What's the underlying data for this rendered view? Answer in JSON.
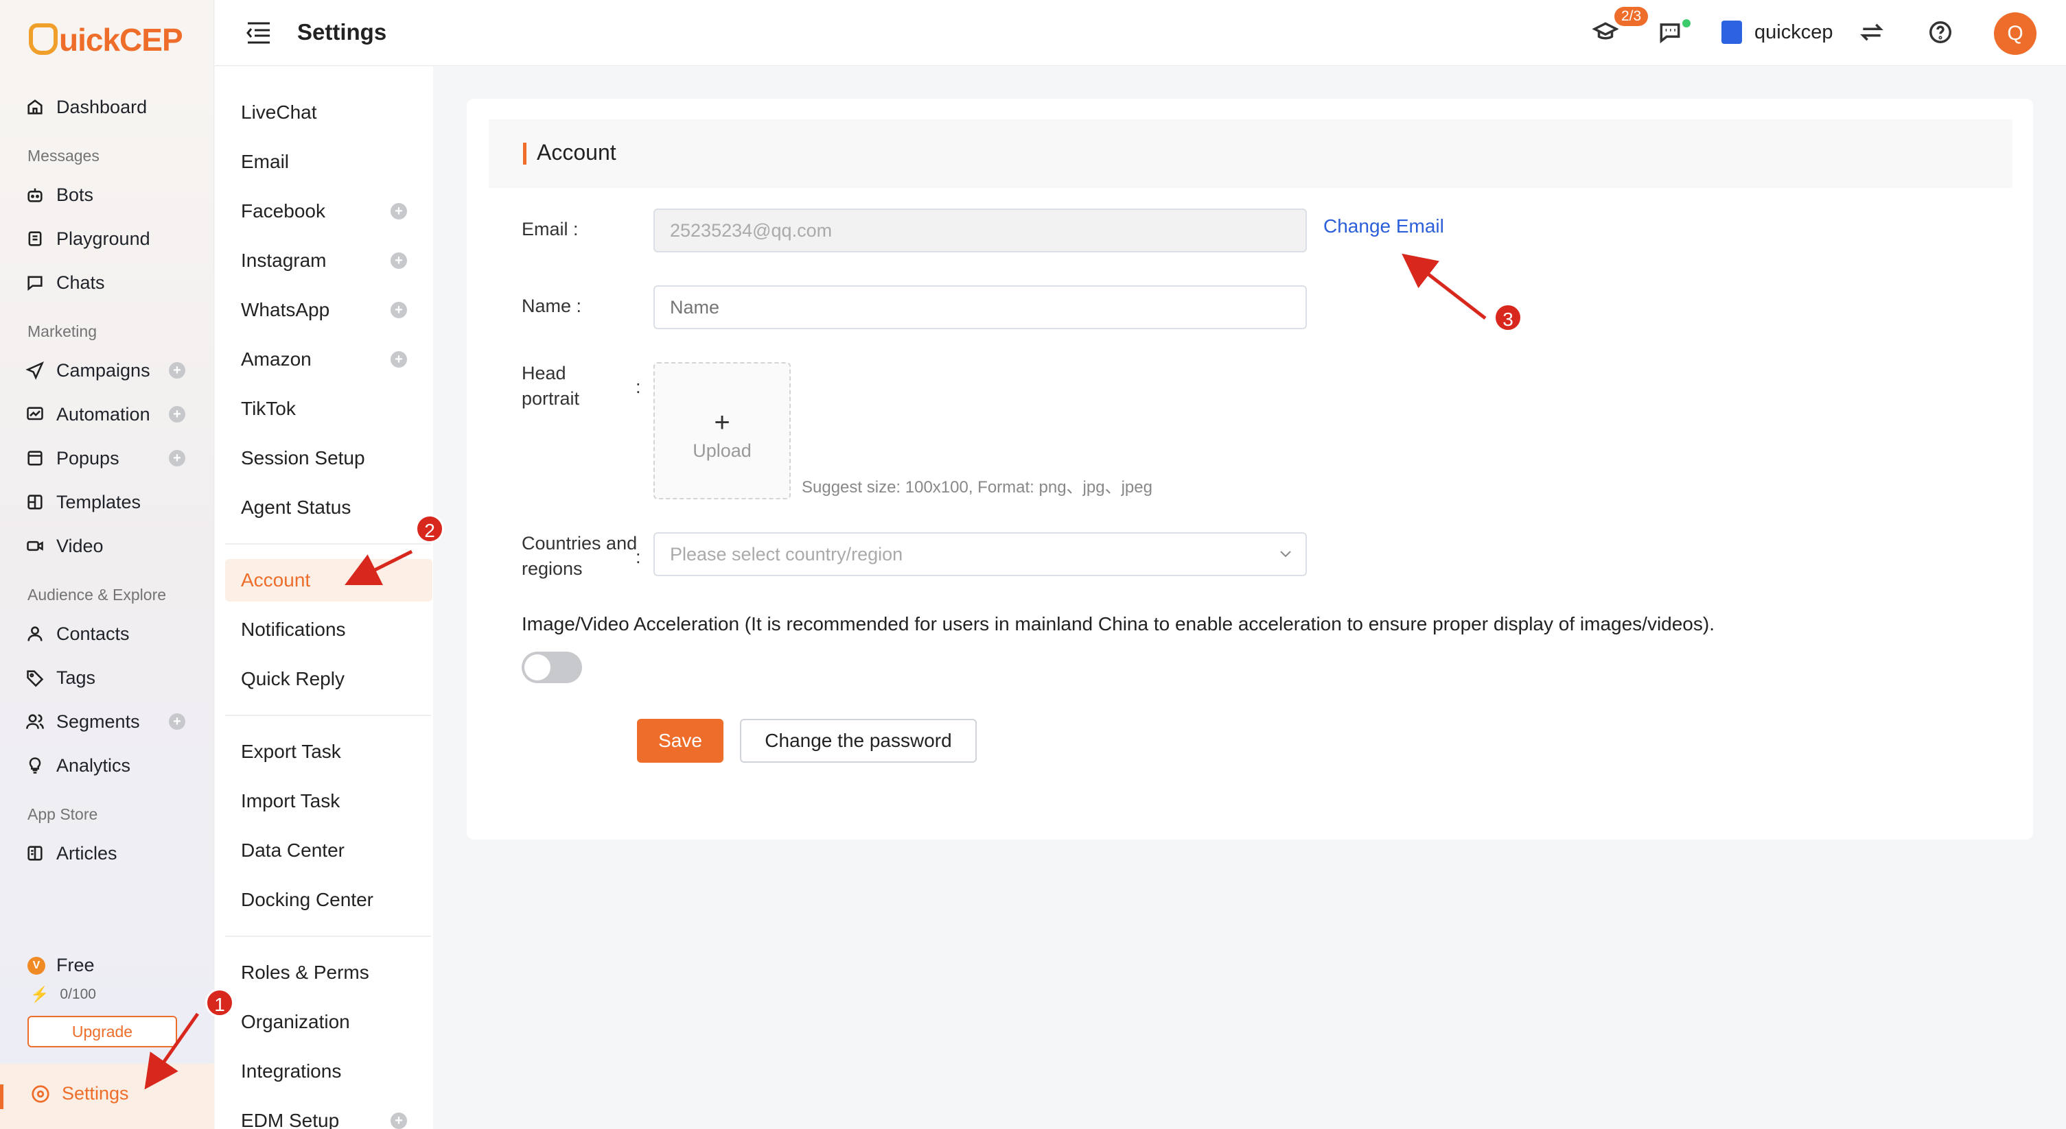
{
  "brand": {
    "logo_text": "uickCEP"
  },
  "sidebar": {
    "items": [
      {
        "label": "Dashboard",
        "icon": "home-icon"
      },
      {
        "group": "Messages"
      },
      {
        "label": "Bots",
        "icon": "bot-icon"
      },
      {
        "label": "Playground",
        "icon": "playground-icon"
      },
      {
        "label": "Chats",
        "icon": "chat-icon"
      },
      {
        "group": "Marketing"
      },
      {
        "label": "Campaigns",
        "icon": "send-icon"
      },
      {
        "label": "Automation",
        "icon": "automation-icon"
      },
      {
        "label": "Popups",
        "icon": "popup-icon"
      },
      {
        "label": "Templates",
        "icon": "template-icon"
      },
      {
        "label": "Video",
        "icon": "video-icon"
      },
      {
        "group": "Audience & Explore"
      },
      {
        "label": "Contacts",
        "icon": "user-icon"
      },
      {
        "label": "Tags",
        "icon": "tag-icon"
      },
      {
        "label": "Segments",
        "icon": "users-icon"
      },
      {
        "label": "Analytics",
        "icon": "bulb-icon"
      },
      {
        "group": "App Store"
      },
      {
        "label": "Articles",
        "icon": "book-icon"
      }
    ],
    "plan": {
      "name": "Free",
      "quota": "0/100",
      "upgrade_label": "Upgrade"
    },
    "settings_label": "Settings"
  },
  "header": {
    "title": "Settings",
    "badge": "2/3",
    "shop_name": "quickcep",
    "avatar_initial": "Q"
  },
  "submenu": {
    "items": [
      "LiveChat",
      "Email",
      "Facebook",
      "Instagram",
      "WhatsApp",
      "Amazon",
      "TikTok",
      "Session Setup",
      "Agent Status",
      "Account",
      "Notifications",
      "Quick Reply",
      "Export Task",
      "Import Task",
      "Data Center",
      "Docking Center",
      "Roles & Perms",
      "Organization",
      "Integrations",
      "EDM Setup"
    ],
    "active": "Account"
  },
  "account": {
    "section_title": "Account",
    "email_label": "Email :",
    "email_value": "25235234@qq.com",
    "change_email": "Change Email",
    "name_label": "Name :",
    "name_placeholder": "Name",
    "portrait_label": "Head portrait",
    "colon": ":",
    "upload_plus": "+",
    "upload_label": "Upload",
    "upload_hint": "Suggest size: 100x100, Format: png、jpg、jpeg",
    "country_label": "Countries and regions",
    "country_placeholder": "Please select country/region",
    "accel_text": "Image/Video Acceleration (It is recommended for users in mainland China to enable acceleration to ensure proper display of images/videos).",
    "accel_enabled": false,
    "save_label": "Save",
    "password_label": "Change the password"
  },
  "annotations": {
    "step1": "1",
    "step2": "2",
    "step3": "3"
  },
  "colors": {
    "accent": "#ee6d2a",
    "link": "#2a5fd9",
    "annotation": "#d8281d"
  }
}
